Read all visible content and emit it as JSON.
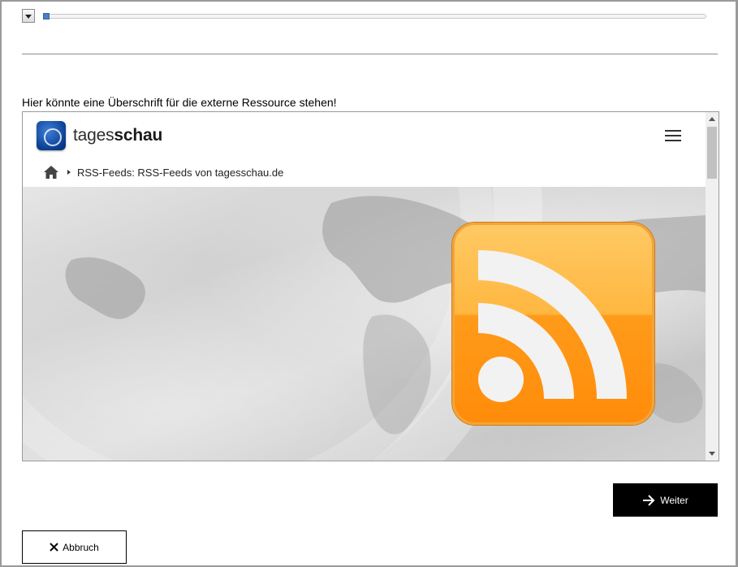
{
  "progress": {
    "value_fraction": 0.0
  },
  "heading": "Hier könnte eine Überschrift für die externe Ressource stehen!",
  "embed": {
    "brand_light": "tages",
    "brand_bold": "schau",
    "breadcrumb": "RSS-Feeds: RSS-Feeds von tagesschau.de",
    "icons": [
      "tagesschau-logo-icon",
      "hamburger-menu-icon",
      "home-icon",
      "rss-icon"
    ]
  },
  "buttons": {
    "next_label": "Weiter",
    "cancel_label": "Abbruch"
  },
  "colors": {
    "primary_button": "#000000",
    "rss_orange": "#ff9b1a",
    "progress_knob": "#4a7fc6"
  }
}
